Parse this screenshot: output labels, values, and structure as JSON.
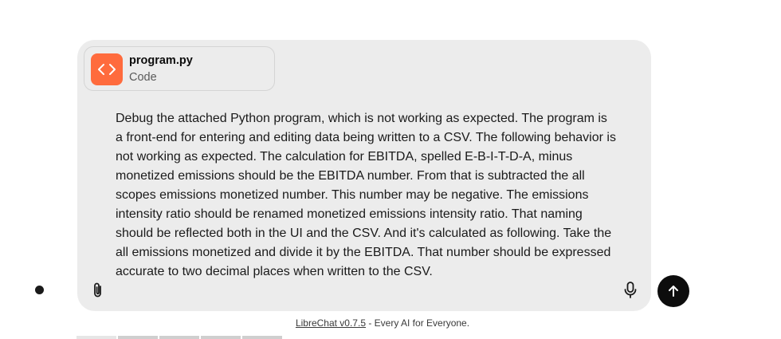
{
  "attachment": {
    "file_name": "program.py",
    "file_type": "Code",
    "icon": "code-icon",
    "icon_color": "#ff6b3d"
  },
  "message": {
    "text": "Debug the attached Python program, which is not working as expected. The program is a front-end for entering and editing data being written to a CSV. The following behavior is not working as expected. The calculation for EBITDA, spelled E-B-I-T-D-A, minus monetized emissions should be the EBITDA number. From that is subtracted the all scopes emissions monetized number. This number may be negative. The emissions intensity ratio should be renamed monetized emissions intensity ratio. That naming should be reflected both in the UI and the CSV. And it's calculated as following. Take the all emissions monetized and divide it by the EBITDA. That number should be expressed accurate to two decimal places when written to the CSV."
  },
  "controls": {
    "attach_icon": "paperclip-icon",
    "mic_icon": "microphone-icon",
    "send_icon": "arrow-up-icon"
  },
  "footer": {
    "link_text": "LibreChat v0.7.5",
    "tagline": " - Every AI for Everyone."
  }
}
